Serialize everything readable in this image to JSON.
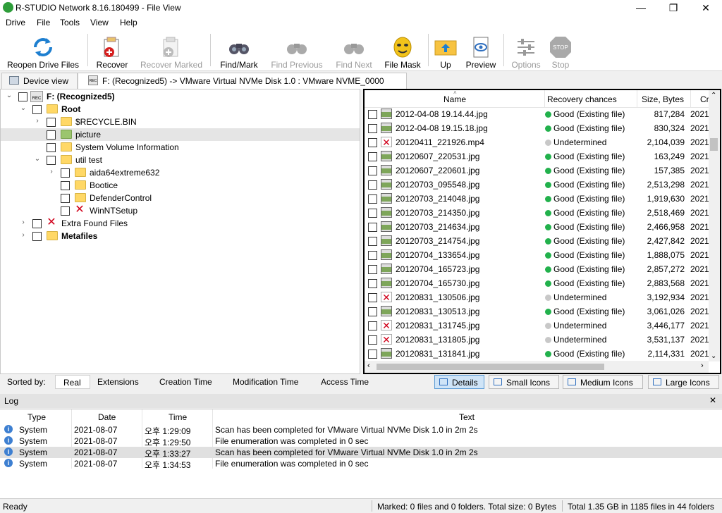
{
  "window": {
    "title": "R-STUDIO Network 8.16.180499 - File View",
    "minimize": "—",
    "maximize": "❐",
    "close": "✕"
  },
  "menu": [
    "Drive",
    "File",
    "Tools",
    "View",
    "Help"
  ],
  "toolbar": {
    "reopen": "Reopen Drive Files",
    "recover": "Recover",
    "recover_marked": "Recover Marked",
    "find_mark": "Find/Mark",
    "find_previous": "Find Previous",
    "find_next": "Find Next",
    "file_mask": "File Mask",
    "up": "Up",
    "preview": "Preview",
    "options": "Options",
    "stop": "Stop",
    "stop_icon_text": "STOP"
  },
  "tabs": {
    "device_view": "Device view",
    "current": "F: (Recognized5) -> VMware Virtual NVMe Disk 1.0 : VMware NVME_0000",
    "rec_badge": "REC"
  },
  "tree": {
    "root_drive": "F: (Recognized5)",
    "root": "Root",
    "recycle": "$RECYCLE.BIN",
    "picture": "picture",
    "svi": "System Volume Information",
    "util": "util test",
    "aida": "aida64extreme632",
    "bootice": "Bootice",
    "defender": "DefenderControl",
    "winnt": "WinNTSetup",
    "extra": "Extra Found Files",
    "metafiles": "Metafiles"
  },
  "file_list": {
    "columns": {
      "name": "Name",
      "chances": "Recovery chances",
      "size": "Size, Bytes",
      "created": "Cr"
    },
    "files": [
      {
        "name": "2012-04-08 19.14.44.jpg",
        "chance": "Good (Existing file)",
        "status": "good",
        "size": "817,284",
        "date": "2021"
      },
      {
        "name": "2012-04-08 19.15.18.jpg",
        "chance": "Good (Existing file)",
        "status": "good",
        "size": "830,324",
        "date": "2021"
      },
      {
        "name": "20120411_221926.mp4",
        "chance": "Undetermined",
        "status": "undetermined",
        "size": "2,104,039",
        "date": "2021"
      },
      {
        "name": "20120607_220531.jpg",
        "chance": "Good (Existing file)",
        "status": "good",
        "size": "163,249",
        "date": "2021"
      },
      {
        "name": "20120607_220601.jpg",
        "chance": "Good (Existing file)",
        "status": "good",
        "size": "157,385",
        "date": "2021"
      },
      {
        "name": "20120703_095548.jpg",
        "chance": "Good (Existing file)",
        "status": "good",
        "size": "2,513,298",
        "date": "2021"
      },
      {
        "name": "20120703_214048.jpg",
        "chance": "Good (Existing file)",
        "status": "good",
        "size": "1,919,630",
        "date": "2021"
      },
      {
        "name": "20120703_214350.jpg",
        "chance": "Good (Existing file)",
        "status": "good",
        "size": "2,518,469",
        "date": "2021"
      },
      {
        "name": "20120703_214634.jpg",
        "chance": "Good (Existing file)",
        "status": "good",
        "size": "2,466,958",
        "date": "2021"
      },
      {
        "name": "20120703_214754.jpg",
        "chance": "Good (Existing file)",
        "status": "good",
        "size": "2,427,842",
        "date": "2021"
      },
      {
        "name": "20120704_133654.jpg",
        "chance": "Good (Existing file)",
        "status": "good",
        "size": "1,888,075",
        "date": "2021"
      },
      {
        "name": "20120704_165723.jpg",
        "chance": "Good (Existing file)",
        "status": "good",
        "size": "2,857,272",
        "date": "2021"
      },
      {
        "name": "20120704_165730.jpg",
        "chance": "Good (Existing file)",
        "status": "good",
        "size": "2,883,568",
        "date": "2021"
      },
      {
        "name": "20120831_130506.jpg",
        "chance": "Undetermined",
        "status": "undetermined",
        "size": "3,192,934",
        "date": "2021"
      },
      {
        "name": "20120831_130513.jpg",
        "chance": "Good (Existing file)",
        "status": "good",
        "size": "3,061,026",
        "date": "2021"
      },
      {
        "name": "20120831_131745.jpg",
        "chance": "Undetermined",
        "status": "undetermined",
        "size": "3,446,177",
        "date": "2021"
      },
      {
        "name": "20120831_131805.jpg",
        "chance": "Undetermined",
        "status": "undetermined",
        "size": "3,531,137",
        "date": "2021"
      },
      {
        "name": "20120831_131841.jpg",
        "chance": "Good (Existing file)",
        "status": "good",
        "size": "2,114,331",
        "date": "2021"
      }
    ]
  },
  "sortbar": {
    "label": "Sorted by:",
    "options": [
      "Real",
      "Extensions",
      "Creation Time",
      "Modification Time",
      "Access Time"
    ],
    "views": [
      "Details",
      "Small Icons",
      "Medium Icons",
      "Large Icons"
    ]
  },
  "log": {
    "title": "Log",
    "close": "✕",
    "columns": [
      "Type",
      "Date",
      "Time",
      "Text"
    ],
    "rows": [
      {
        "type": "System",
        "date": "2021-08-07",
        "time": "오후 1:29:09",
        "text": "Scan has been completed for VMware Virtual NVMe Disk 1.0 in 2m 2s"
      },
      {
        "type": "System",
        "date": "2021-08-07",
        "time": "오후 1:29:50",
        "text": "File enumeration was completed in 0 sec"
      },
      {
        "type": "System",
        "date": "2021-08-07",
        "time": "오후 1:33:27",
        "text": "Scan has been completed for VMware Virtual NVMe Disk 1.0 in 2m 2s"
      },
      {
        "type": "System",
        "date": "2021-08-07",
        "time": "오후 1:34:53",
        "text": "File enumeration was completed in 0 sec"
      }
    ]
  },
  "status": {
    "ready": "Ready",
    "marked": "Marked: 0 files and 0 folders. Total size: 0 Bytes",
    "total": "Total 1.35 GB in 1185 files in 44 folders"
  },
  "colors": {
    "good": "#22b14c",
    "undetermined": "#c8c8c8",
    "accent": "#2f8fd9"
  }
}
